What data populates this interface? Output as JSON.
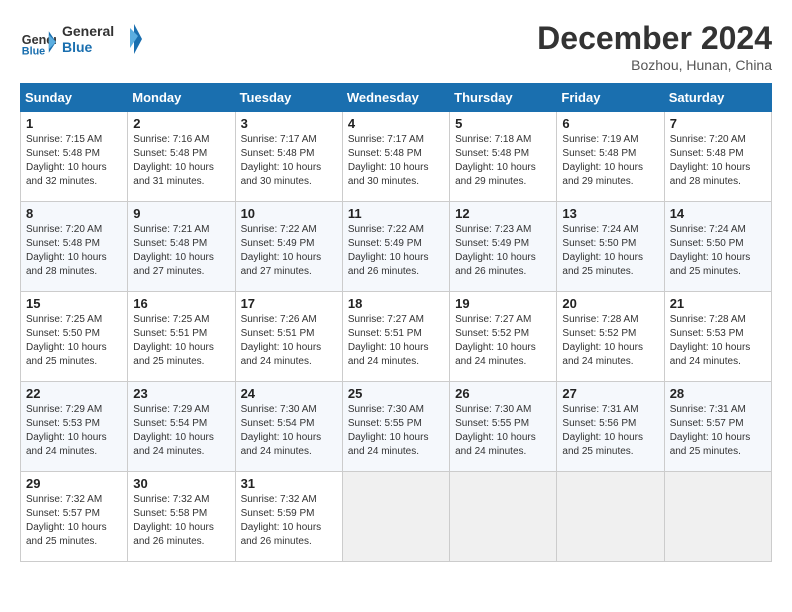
{
  "logo": {
    "line1": "General",
    "line2": "Blue"
  },
  "title": "December 2024",
  "location": "Bozhou, Hunan, China",
  "days_of_week": [
    "Sunday",
    "Monday",
    "Tuesday",
    "Wednesday",
    "Thursday",
    "Friday",
    "Saturday"
  ],
  "weeks": [
    [
      {
        "day": 1,
        "info": "Sunrise: 7:15 AM\nSunset: 5:48 PM\nDaylight: 10 hours\nand 32 minutes."
      },
      {
        "day": 2,
        "info": "Sunrise: 7:16 AM\nSunset: 5:48 PM\nDaylight: 10 hours\nand 31 minutes."
      },
      {
        "day": 3,
        "info": "Sunrise: 7:17 AM\nSunset: 5:48 PM\nDaylight: 10 hours\nand 30 minutes."
      },
      {
        "day": 4,
        "info": "Sunrise: 7:17 AM\nSunset: 5:48 PM\nDaylight: 10 hours\nand 30 minutes."
      },
      {
        "day": 5,
        "info": "Sunrise: 7:18 AM\nSunset: 5:48 PM\nDaylight: 10 hours\nand 29 minutes."
      },
      {
        "day": 6,
        "info": "Sunrise: 7:19 AM\nSunset: 5:48 PM\nDaylight: 10 hours\nand 29 minutes."
      },
      {
        "day": 7,
        "info": "Sunrise: 7:20 AM\nSunset: 5:48 PM\nDaylight: 10 hours\nand 28 minutes."
      }
    ],
    [
      {
        "day": 8,
        "info": "Sunrise: 7:20 AM\nSunset: 5:48 PM\nDaylight: 10 hours\nand 28 minutes."
      },
      {
        "day": 9,
        "info": "Sunrise: 7:21 AM\nSunset: 5:48 PM\nDaylight: 10 hours\nand 27 minutes."
      },
      {
        "day": 10,
        "info": "Sunrise: 7:22 AM\nSunset: 5:49 PM\nDaylight: 10 hours\nand 27 minutes."
      },
      {
        "day": 11,
        "info": "Sunrise: 7:22 AM\nSunset: 5:49 PM\nDaylight: 10 hours\nand 26 minutes."
      },
      {
        "day": 12,
        "info": "Sunrise: 7:23 AM\nSunset: 5:49 PM\nDaylight: 10 hours\nand 26 minutes."
      },
      {
        "day": 13,
        "info": "Sunrise: 7:24 AM\nSunset: 5:50 PM\nDaylight: 10 hours\nand 25 minutes."
      },
      {
        "day": 14,
        "info": "Sunrise: 7:24 AM\nSunset: 5:50 PM\nDaylight: 10 hours\nand 25 minutes."
      }
    ],
    [
      {
        "day": 15,
        "info": "Sunrise: 7:25 AM\nSunset: 5:50 PM\nDaylight: 10 hours\nand 25 minutes."
      },
      {
        "day": 16,
        "info": "Sunrise: 7:25 AM\nSunset: 5:51 PM\nDaylight: 10 hours\nand 25 minutes."
      },
      {
        "day": 17,
        "info": "Sunrise: 7:26 AM\nSunset: 5:51 PM\nDaylight: 10 hours\nand 24 minutes."
      },
      {
        "day": 18,
        "info": "Sunrise: 7:27 AM\nSunset: 5:51 PM\nDaylight: 10 hours\nand 24 minutes."
      },
      {
        "day": 19,
        "info": "Sunrise: 7:27 AM\nSunset: 5:52 PM\nDaylight: 10 hours\nand 24 minutes."
      },
      {
        "day": 20,
        "info": "Sunrise: 7:28 AM\nSunset: 5:52 PM\nDaylight: 10 hours\nand 24 minutes."
      },
      {
        "day": 21,
        "info": "Sunrise: 7:28 AM\nSunset: 5:53 PM\nDaylight: 10 hours\nand 24 minutes."
      }
    ],
    [
      {
        "day": 22,
        "info": "Sunrise: 7:29 AM\nSunset: 5:53 PM\nDaylight: 10 hours\nand 24 minutes."
      },
      {
        "day": 23,
        "info": "Sunrise: 7:29 AM\nSunset: 5:54 PM\nDaylight: 10 hours\nand 24 minutes."
      },
      {
        "day": 24,
        "info": "Sunrise: 7:30 AM\nSunset: 5:54 PM\nDaylight: 10 hours\nand 24 minutes."
      },
      {
        "day": 25,
        "info": "Sunrise: 7:30 AM\nSunset: 5:55 PM\nDaylight: 10 hours\nand 24 minutes."
      },
      {
        "day": 26,
        "info": "Sunrise: 7:30 AM\nSunset: 5:55 PM\nDaylight: 10 hours\nand 24 minutes."
      },
      {
        "day": 27,
        "info": "Sunrise: 7:31 AM\nSunset: 5:56 PM\nDaylight: 10 hours\nand 25 minutes."
      },
      {
        "day": 28,
        "info": "Sunrise: 7:31 AM\nSunset: 5:57 PM\nDaylight: 10 hours\nand 25 minutes."
      }
    ],
    [
      {
        "day": 29,
        "info": "Sunrise: 7:32 AM\nSunset: 5:57 PM\nDaylight: 10 hours\nand 25 minutes."
      },
      {
        "day": 30,
        "info": "Sunrise: 7:32 AM\nSunset: 5:58 PM\nDaylight: 10 hours\nand 26 minutes."
      },
      {
        "day": 31,
        "info": "Sunrise: 7:32 AM\nSunset: 5:59 PM\nDaylight: 10 hours\nand 26 minutes."
      },
      null,
      null,
      null,
      null
    ]
  ]
}
